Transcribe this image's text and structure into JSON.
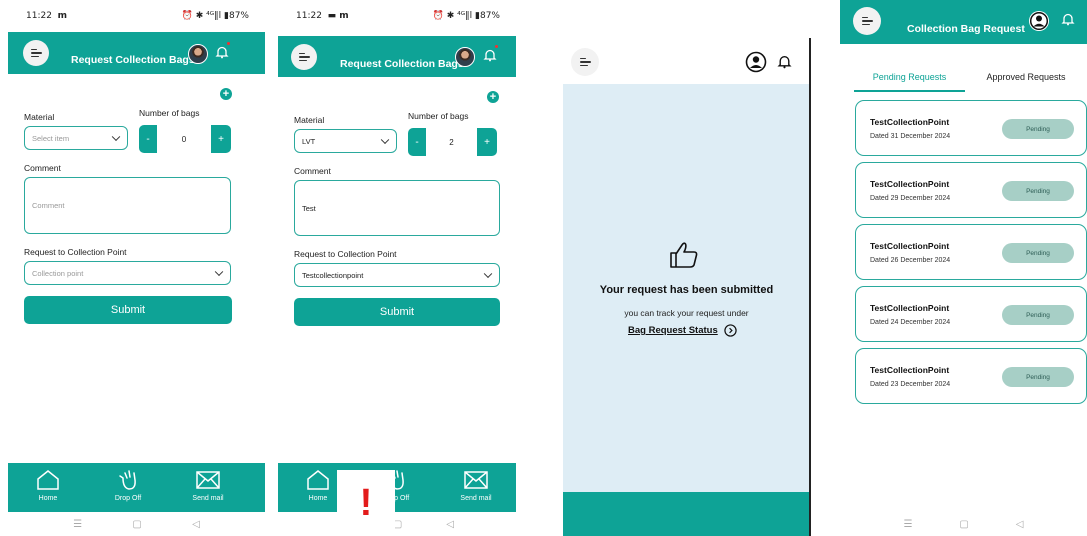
{
  "screen1": {
    "status_time": "11:22",
    "status_extra": "m",
    "status_right": "⏰ ✱ ⁴ᴳ‖l ▮87%",
    "header_title": "Request Collection Bags",
    "material_label": "Material",
    "material_placeholder": "Select item",
    "bags_label": "Number of bags",
    "bags_value": "0",
    "minus": "-",
    "plus": "+",
    "add_icon": "+",
    "comment_label": "Comment",
    "comment_placeholder": "Comment",
    "cp_label": "Request to Collection Point",
    "cp_placeholder": "Collection point",
    "submit_label": "Submit",
    "nav": [
      "Home",
      "Drop Off",
      "Send mail"
    ]
  },
  "screen2": {
    "status_time": "11:22",
    "status_extra": "▬ m",
    "status_right": "⏰ ✱ ⁴ᴳ‖l ▮87%",
    "header_title": "Request Collection Bags",
    "material_label": "Material",
    "material_value": "LVT",
    "bags_label": "Number of bags",
    "bags_value": "2",
    "minus": "-",
    "plus": "+",
    "add_icon": "+",
    "comment_label": "Comment",
    "comment_value": "Test",
    "cp_label": "Request to Collection Point",
    "cp_value": "Testcollectionpoint",
    "submit_label": "Submit",
    "nav": [
      "Home",
      "Drop Off",
      "Send mail"
    ],
    "warning_mark": "!"
  },
  "screen3": {
    "title": "Your request has been submitted",
    "subtitle": "you can track your request under",
    "link": "Bag Request Status"
  },
  "screen4": {
    "header_title": "Collection Bag Request",
    "tabs": [
      "Pending Requests",
      "Approved Requests"
    ],
    "requests": [
      {
        "name": "TestCollectionPoint",
        "date": "Dated 31 December 2024",
        "status": "Pending"
      },
      {
        "name": "TestCollectionPoint",
        "date": "Dated 29 December 2024",
        "status": "Pending"
      },
      {
        "name": "TestCollectionPoint",
        "date": "Dated 26 December 2024",
        "status": "Pending"
      },
      {
        "name": "TestCollectionPoint",
        "date": "Dated 24 December 2024",
        "status": "Pending"
      },
      {
        "name": "TestCollectionPoint",
        "date": "Dated 23 December 2024",
        "status": "Pending"
      }
    ]
  },
  "system_nav": [
    "☰",
    "▢",
    "◁"
  ],
  "colors": {
    "accent": "#0ea396",
    "pill": "#a7cfc6",
    "submitted_bg": "#deedf5"
  },
  "icons": [
    "menu-icon",
    "avatar",
    "bell-icon",
    "add-icon",
    "chevron-down-icon",
    "home-icon",
    "drop-off-icon",
    "mail-icon",
    "thumbs-up-icon",
    "arrow-circle-right-icon",
    "user-circle-icon"
  ]
}
